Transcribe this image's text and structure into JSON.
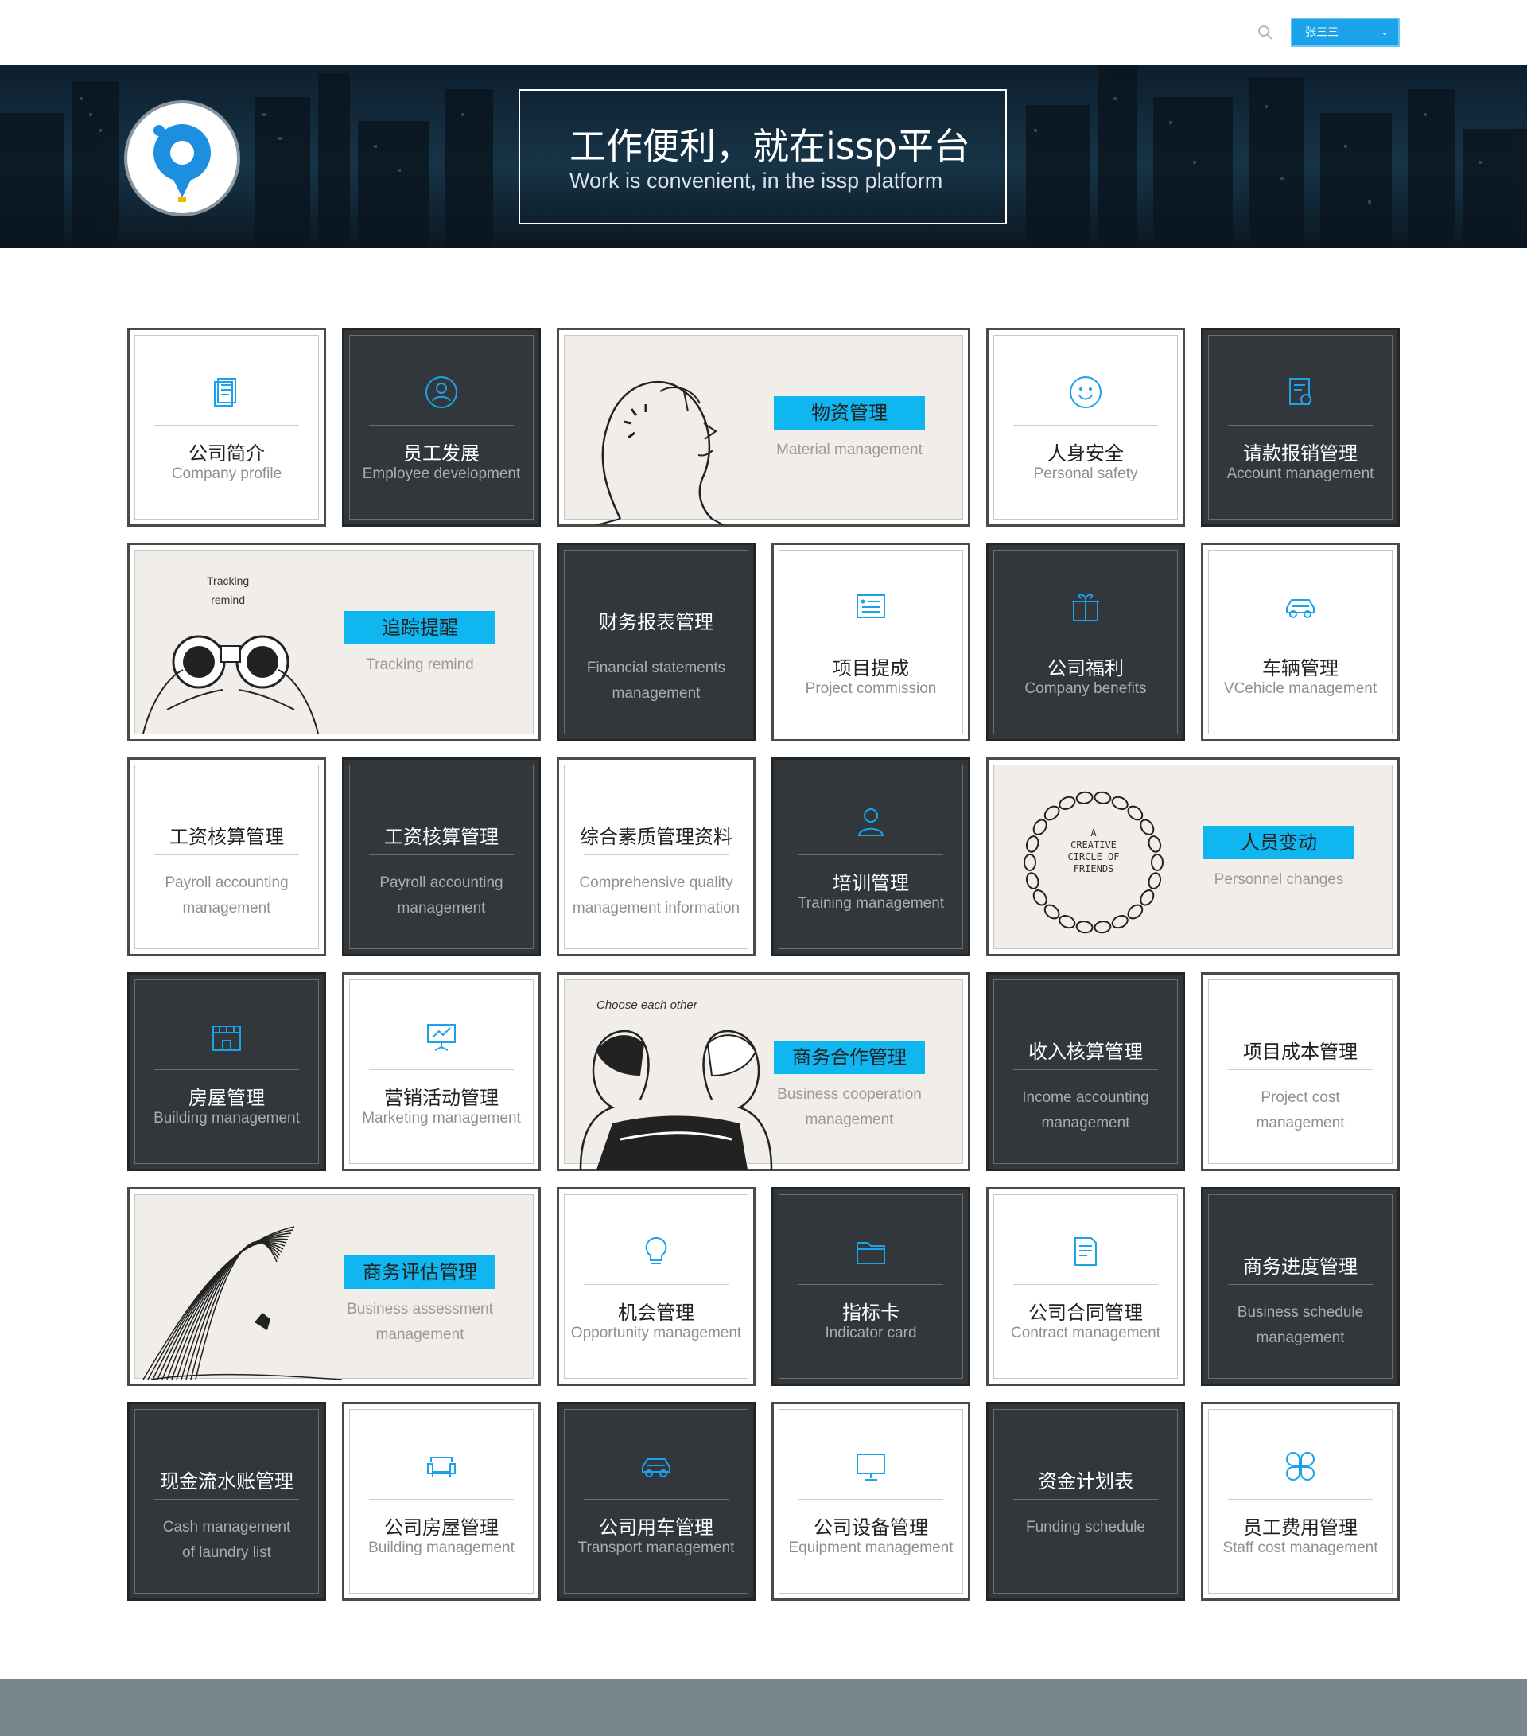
{
  "header": {
    "user_name": "张三三"
  },
  "banner": {
    "title": "工作便利，就在issp平台",
    "subtitle": "Work is convenient, in the issp platform"
  },
  "colors": {
    "accent": "#0fb6f0",
    "dark_tile": "#32373c",
    "footer": "#78878e"
  },
  "tiles": [
    {
      "cn": "公司简介",
      "en": "Company profile",
      "icon": "document-icon"
    },
    {
      "cn": "员工发展",
      "en": "Employee development",
      "icon": "user-circle-icon"
    },
    {
      "cn": "物资管理",
      "en": "Material management",
      "illus": "thinking-man-illustration"
    },
    {
      "cn": "人身安全",
      "en": "Personal safety",
      "icon": "smile-icon"
    },
    {
      "cn": "请款报销管理",
      "en": "Account management",
      "icon": "invoice-icon"
    },
    {
      "cn": "追踪提醒",
      "en": "Tracking remind",
      "illus": "binoculars-illustration",
      "illus_text": "Tracking\nremind"
    },
    {
      "cn": "财务报表管理",
      "en": "Financial statements\nmanagement"
    },
    {
      "cn": "项目提成",
      "en": "Project commission",
      "icon": "list-card-icon"
    },
    {
      "cn": "公司福利",
      "en": "Company benefits",
      "icon": "gift-icon"
    },
    {
      "cn": "车辆管理",
      "en": "VCehicle management",
      "icon": "car-icon"
    },
    {
      "cn": "工资核算管理",
      "en": "Payroll accounting\nmanagement"
    },
    {
      "cn": "工资核算管理",
      "en": "Payroll accounting\nmanagement"
    },
    {
      "cn": "综合素质管理资料",
      "en": "Comprehensive quality\nmanagement information"
    },
    {
      "cn": "培训管理",
      "en": "Training management",
      "icon": "person-icon"
    },
    {
      "cn": "人员变动",
      "en": "Personnel changes",
      "illus": "circle-of-friends-illustration",
      "illus_text": "A\nCREATIVE\nCIRCLE OF\nFRIENDS"
    },
    {
      "cn": "房屋管理",
      "en": "Building management",
      "icon": "store-icon"
    },
    {
      "cn": "营销活动管理",
      "en": "Marketing management",
      "icon": "presentation-icon"
    },
    {
      "cn": "商务合作管理",
      "en": "Business cooperation\nmanagement",
      "illus": "choose-each-other-illustration",
      "illus_text": "Choose each other"
    },
    {
      "cn": "收入核算管理",
      "en": "Income accounting\nmanagement"
    },
    {
      "cn": "项目成本管理",
      "en": "Project cost\nmanagement"
    },
    {
      "cn": "商务评估管理",
      "en": "Business assessment\nmanagement",
      "illus": "wave-illustration"
    },
    {
      "cn": "机会管理",
      "en": "Opportunity management",
      "icon": "lightbulb-icon"
    },
    {
      "cn": "指标卡",
      "en": "Indicator card",
      "icon": "folder-icon"
    },
    {
      "cn": "公司合同管理",
      "en": "Contract management",
      "icon": "contract-icon"
    },
    {
      "cn": "商务进度管理",
      "en": "Business schedule\nmanagement"
    },
    {
      "cn": "现金流水账管理",
      "en": "Cash management\nof laundry list"
    },
    {
      "cn": "公司房屋管理",
      "en": "Building management",
      "icon": "sofa-icon"
    },
    {
      "cn": "公司用车管理",
      "en": "Transport management",
      "icon": "car-icon"
    },
    {
      "cn": "公司设备管理",
      "en": "Equipment management",
      "icon": "monitor-icon"
    },
    {
      "cn": "资金计划表",
      "en": "Funding schedule"
    },
    {
      "cn": "员工费用管理",
      "en": "Staff cost management",
      "icon": "clover-icon"
    }
  ]
}
